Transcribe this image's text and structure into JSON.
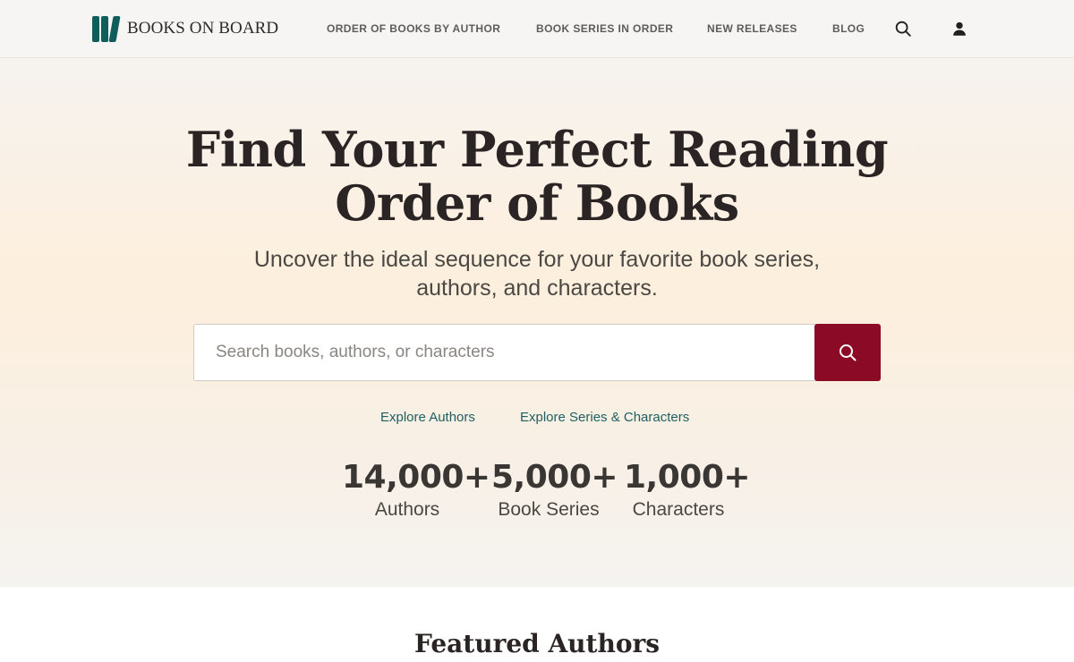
{
  "header": {
    "logo_text": "BOOKS ON BOARD",
    "nav": [
      {
        "label": "ORDER OF BOOKS BY AUTHOR"
      },
      {
        "label": "BOOK SERIES IN ORDER"
      },
      {
        "label": "NEW RELEASES"
      },
      {
        "label": "BLOG"
      }
    ],
    "icons": [
      "search-icon",
      "user-icon"
    ]
  },
  "hero": {
    "title_line1": "Find Your Perfect Reading",
    "title_line2": "Order of Books",
    "subtitle_line1": "Uncover the ideal sequence for your favorite book series,",
    "subtitle_line2": "authors, and characters.",
    "search": {
      "placeholder": "Search books, authors, or characters",
      "value": "",
      "button_icon": "search-icon"
    },
    "links": [
      {
        "label": "Explore Authors"
      },
      {
        "label": "Explore Series & Characters"
      }
    ],
    "stats": [
      {
        "number": "14,000+",
        "label": "Authors"
      },
      {
        "number": "5,000+",
        "label": "Book Series"
      },
      {
        "number": "1,000+",
        "label": "Characters"
      }
    ]
  },
  "featured": {
    "title": "Featured Authors"
  },
  "colors": {
    "brand_teal": "#0f5e5c",
    "search_button": "#8b0a26",
    "link_teal": "#1f5f63"
  }
}
